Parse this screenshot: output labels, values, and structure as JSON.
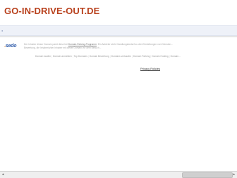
{
  "site": {
    "title": "GO-IN-DRIVE-OUT.DE"
  },
  "sedo": {
    "logo_text": "sedo",
    "logo_dot": "."
  },
  "info": {
    "line1_pre": "Der Inhaber dieser Domain parkt diese bei ",
    "line1_link": "Domain-Parking-Programm",
    "line1_post": ". Ein Anbieter steht Handlungsbedarf zu den Einstellungen von Diensten...",
    "line2": "Bewertung, die Inhaberin/der Inhaber mit dieser Domain vor dem Besuch..."
  },
  "links": [
    "Domain kaufen",
    "Domain anmelden",
    "Top Domains",
    "Domain Bewertung",
    "Domains verkaufen",
    "Domain Parking",
    "Domain Hosting",
    "Domain..."
  ],
  "footer": {
    "privacy": "Privacy Policies"
  },
  "scrollbar": {
    "left_arrow": "◂",
    "right_arrow": "▸"
  },
  "colors": {
    "title": "#b8401c",
    "band": "#eef1f8",
    "sedo_blue": "#2a58a8",
    "sedo_orange": "#f08a1c"
  }
}
